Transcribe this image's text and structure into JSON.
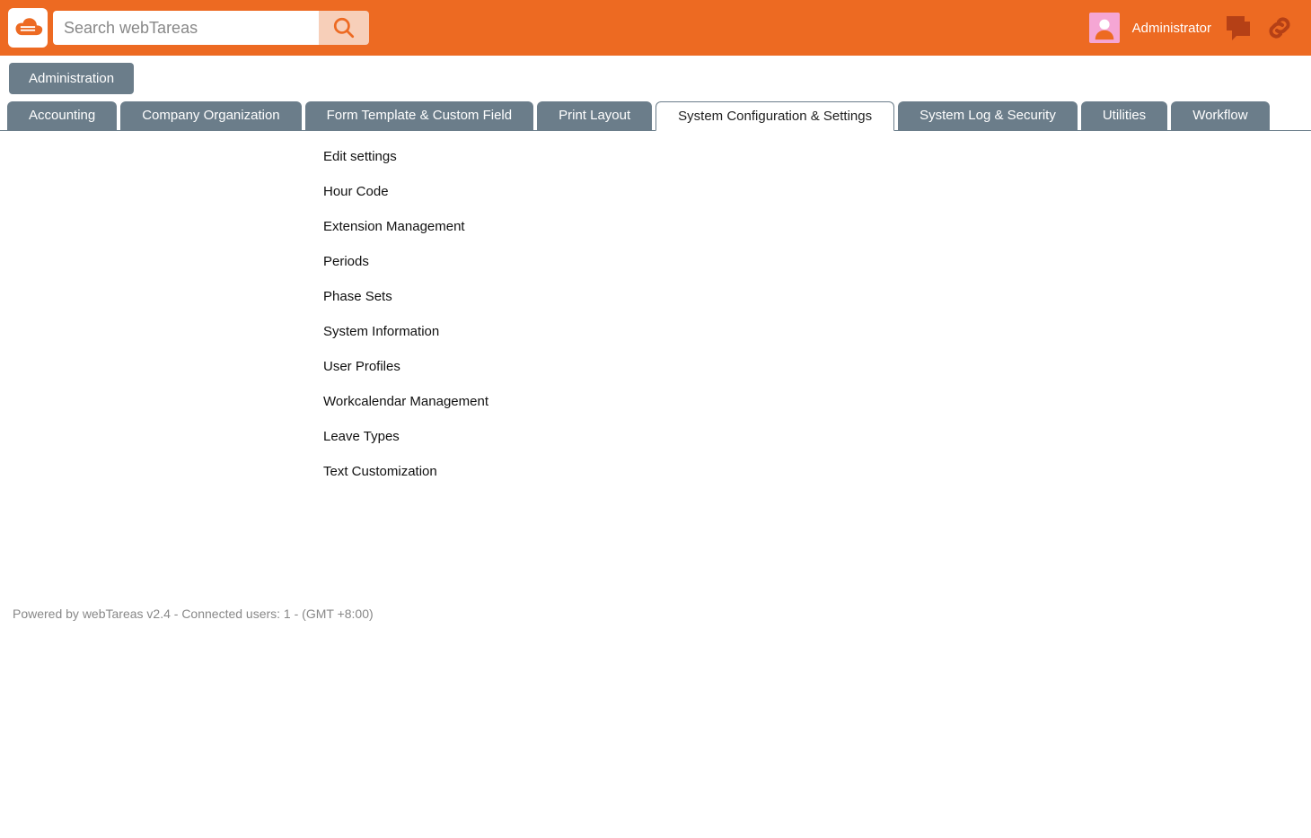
{
  "header": {
    "search_placeholder": "Search webTareas",
    "user_label": "Administrator"
  },
  "breadcrumb": {
    "label": "Administration"
  },
  "tabs": [
    {
      "label": "Accounting",
      "active": false
    },
    {
      "label": "Company Organization",
      "active": false
    },
    {
      "label": "Form Template & Custom Field",
      "active": false
    },
    {
      "label": "Print Layout",
      "active": false
    },
    {
      "label": "System Configuration & Settings",
      "active": true
    },
    {
      "label": "System Log & Security",
      "active": false
    },
    {
      "label": "Utilities",
      "active": false
    },
    {
      "label": "Workflow",
      "active": false
    }
  ],
  "menu": {
    "items": [
      "Edit settings",
      "Hour Code",
      "Extension Management",
      "Periods",
      "Phase Sets",
      "System Information",
      "User Profiles",
      "Workcalendar Management",
      "Leave Types",
      "Text Customization"
    ]
  },
  "footer": {
    "text": "Powered by webTareas v2.4 - Connected users: 1 - (GMT +8:00)"
  }
}
